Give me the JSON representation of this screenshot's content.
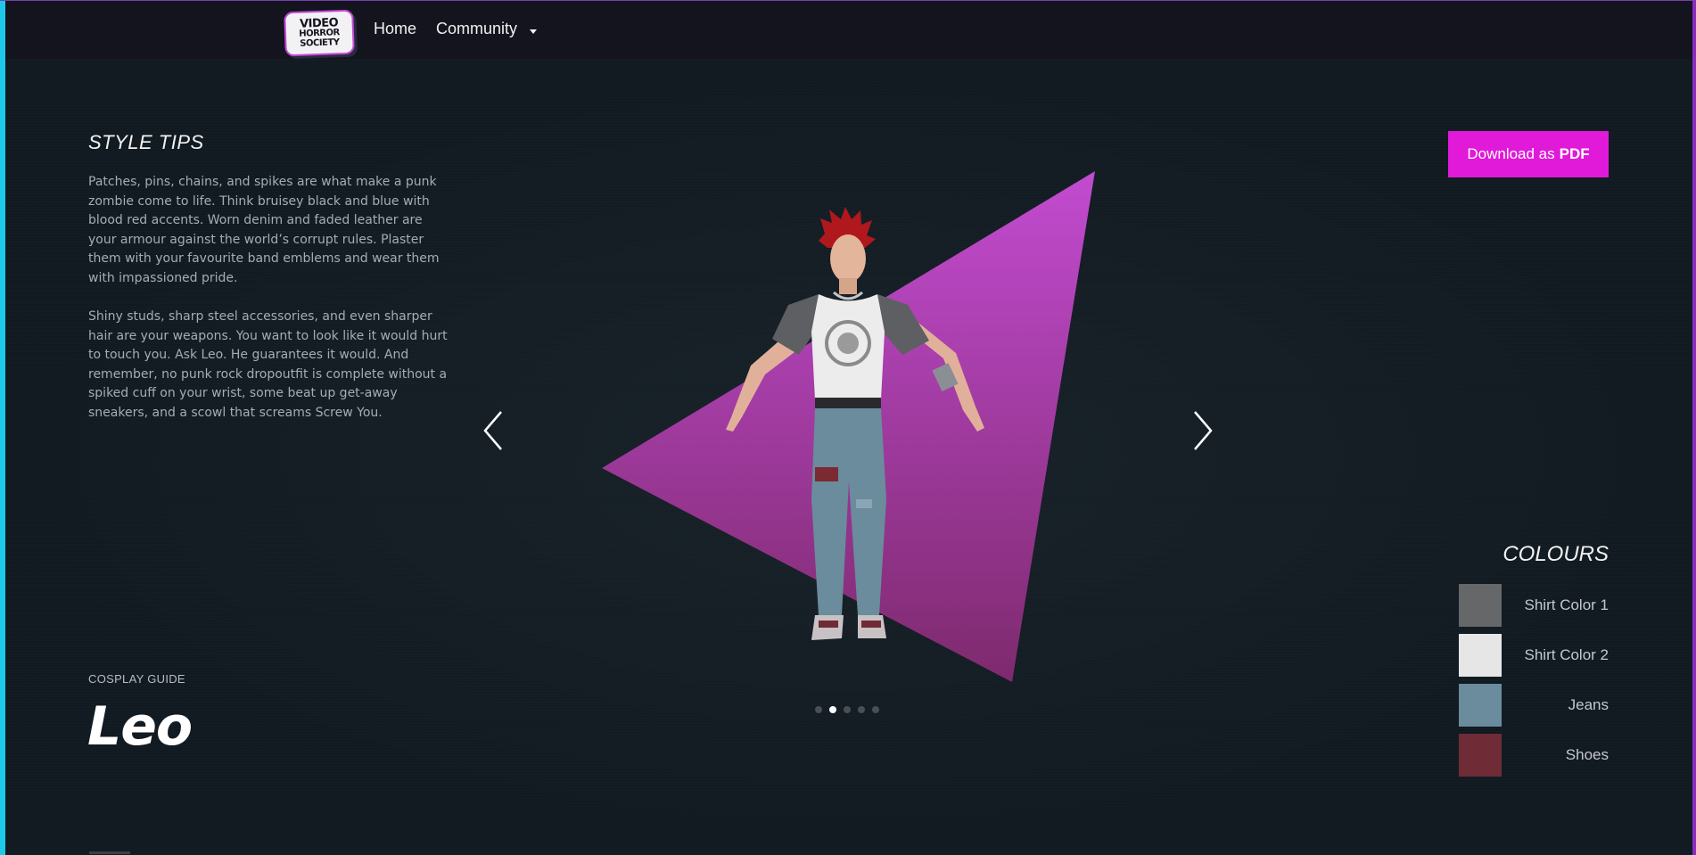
{
  "nav": {
    "logo_line1": "VIDEO",
    "logo_line2": "HORROR",
    "logo_line3": "SOCIETY",
    "home": "Home",
    "community": "Community"
  },
  "style_tips": {
    "title": "STYLE TIPS",
    "paragraph1": "Patches, pins, chains, and spikes are what make a punk zombie come to life. Think bruisey black and blue with blood red accents. Worn denim and faded leather are your armour against the world’s corrupt rules. Plaster them with your favourite band emblems and wear them with impassioned pride.",
    "paragraph2": "Shiny studs, sharp steel accessories, and even sharper hair are your weapons. You want to look like it would hurt to touch you. Ask Leo. He guarantees it would. And remember, no punk rock dropoutfit is complete without a spiked cuff on your wrist, some beat up get-away sneakers, and a scowl that screams Screw You."
  },
  "guide": {
    "label": "COSPLAY GUIDE",
    "name": "Leo"
  },
  "carousel": {
    "slide_count": 5,
    "active_index": 1
  },
  "download": {
    "prefix": "Download as",
    "suffix": "PDF"
  },
  "colours": {
    "title": "COLOURS",
    "items": [
      {
        "label": "Shirt Color 1",
        "color": "#666769"
      },
      {
        "label": "Shirt Color 2",
        "color": "#e6e6e6"
      },
      {
        "label": "Jeans",
        "color": "#6a8c9c"
      },
      {
        "label": "Shoes",
        "color": "#6f2c36"
      }
    ]
  },
  "accent_colors": {
    "brand_magenta": "#e01ad8",
    "triangle_top": "#c24bd0",
    "triangle_bottom": "#7e2a6e"
  }
}
